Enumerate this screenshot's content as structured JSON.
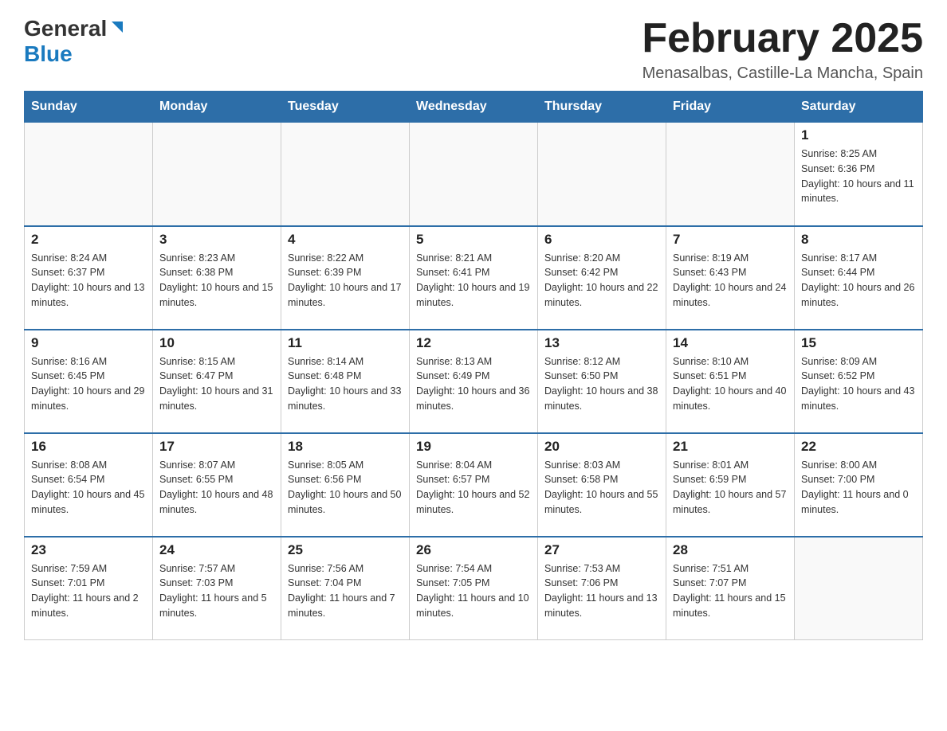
{
  "header": {
    "logo": {
      "general": "General",
      "blue": "Blue",
      "triangle": "▶"
    },
    "title": "February 2025",
    "location": "Menasalbas, Castille-La Mancha, Spain"
  },
  "days_of_week": [
    "Sunday",
    "Monday",
    "Tuesday",
    "Wednesday",
    "Thursday",
    "Friday",
    "Saturday"
  ],
  "weeks": [
    [
      {
        "day": "",
        "info": ""
      },
      {
        "day": "",
        "info": ""
      },
      {
        "day": "",
        "info": ""
      },
      {
        "day": "",
        "info": ""
      },
      {
        "day": "",
        "info": ""
      },
      {
        "day": "",
        "info": ""
      },
      {
        "day": "1",
        "info": "Sunrise: 8:25 AM\nSunset: 6:36 PM\nDaylight: 10 hours and 11 minutes."
      }
    ],
    [
      {
        "day": "2",
        "info": "Sunrise: 8:24 AM\nSunset: 6:37 PM\nDaylight: 10 hours and 13 minutes."
      },
      {
        "day": "3",
        "info": "Sunrise: 8:23 AM\nSunset: 6:38 PM\nDaylight: 10 hours and 15 minutes."
      },
      {
        "day": "4",
        "info": "Sunrise: 8:22 AM\nSunset: 6:39 PM\nDaylight: 10 hours and 17 minutes."
      },
      {
        "day": "5",
        "info": "Sunrise: 8:21 AM\nSunset: 6:41 PM\nDaylight: 10 hours and 19 minutes."
      },
      {
        "day": "6",
        "info": "Sunrise: 8:20 AM\nSunset: 6:42 PM\nDaylight: 10 hours and 22 minutes."
      },
      {
        "day": "7",
        "info": "Sunrise: 8:19 AM\nSunset: 6:43 PM\nDaylight: 10 hours and 24 minutes."
      },
      {
        "day": "8",
        "info": "Sunrise: 8:17 AM\nSunset: 6:44 PM\nDaylight: 10 hours and 26 minutes."
      }
    ],
    [
      {
        "day": "9",
        "info": "Sunrise: 8:16 AM\nSunset: 6:45 PM\nDaylight: 10 hours and 29 minutes."
      },
      {
        "day": "10",
        "info": "Sunrise: 8:15 AM\nSunset: 6:47 PM\nDaylight: 10 hours and 31 minutes."
      },
      {
        "day": "11",
        "info": "Sunrise: 8:14 AM\nSunset: 6:48 PM\nDaylight: 10 hours and 33 minutes."
      },
      {
        "day": "12",
        "info": "Sunrise: 8:13 AM\nSunset: 6:49 PM\nDaylight: 10 hours and 36 minutes."
      },
      {
        "day": "13",
        "info": "Sunrise: 8:12 AM\nSunset: 6:50 PM\nDaylight: 10 hours and 38 minutes."
      },
      {
        "day": "14",
        "info": "Sunrise: 8:10 AM\nSunset: 6:51 PM\nDaylight: 10 hours and 40 minutes."
      },
      {
        "day": "15",
        "info": "Sunrise: 8:09 AM\nSunset: 6:52 PM\nDaylight: 10 hours and 43 minutes."
      }
    ],
    [
      {
        "day": "16",
        "info": "Sunrise: 8:08 AM\nSunset: 6:54 PM\nDaylight: 10 hours and 45 minutes."
      },
      {
        "day": "17",
        "info": "Sunrise: 8:07 AM\nSunset: 6:55 PM\nDaylight: 10 hours and 48 minutes."
      },
      {
        "day": "18",
        "info": "Sunrise: 8:05 AM\nSunset: 6:56 PM\nDaylight: 10 hours and 50 minutes."
      },
      {
        "day": "19",
        "info": "Sunrise: 8:04 AM\nSunset: 6:57 PM\nDaylight: 10 hours and 52 minutes."
      },
      {
        "day": "20",
        "info": "Sunrise: 8:03 AM\nSunset: 6:58 PM\nDaylight: 10 hours and 55 minutes."
      },
      {
        "day": "21",
        "info": "Sunrise: 8:01 AM\nSunset: 6:59 PM\nDaylight: 10 hours and 57 minutes."
      },
      {
        "day": "22",
        "info": "Sunrise: 8:00 AM\nSunset: 7:00 PM\nDaylight: 11 hours and 0 minutes."
      }
    ],
    [
      {
        "day": "23",
        "info": "Sunrise: 7:59 AM\nSunset: 7:01 PM\nDaylight: 11 hours and 2 minutes."
      },
      {
        "day": "24",
        "info": "Sunrise: 7:57 AM\nSunset: 7:03 PM\nDaylight: 11 hours and 5 minutes."
      },
      {
        "day": "25",
        "info": "Sunrise: 7:56 AM\nSunset: 7:04 PM\nDaylight: 11 hours and 7 minutes."
      },
      {
        "day": "26",
        "info": "Sunrise: 7:54 AM\nSunset: 7:05 PM\nDaylight: 11 hours and 10 minutes."
      },
      {
        "day": "27",
        "info": "Sunrise: 7:53 AM\nSunset: 7:06 PM\nDaylight: 11 hours and 13 minutes."
      },
      {
        "day": "28",
        "info": "Sunrise: 7:51 AM\nSunset: 7:07 PM\nDaylight: 11 hours and 15 minutes."
      },
      {
        "day": "",
        "info": ""
      }
    ]
  ]
}
